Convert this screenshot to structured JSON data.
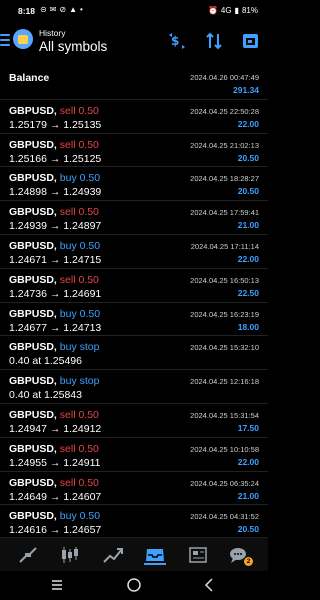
{
  "status_bar": {
    "time": "8:18",
    "notifications": [
      "⊝",
      "✉",
      "⊘",
      "▲",
      "•"
    ],
    "network": "4G",
    "battery": "81%"
  },
  "header": {
    "subtitle": "History",
    "title": "All symbols"
  },
  "balance": {
    "label": "Balance",
    "date": "2024.04.26 00:47:49",
    "value": "291.34"
  },
  "trades": [
    {
      "symbol": "GBPUSD,",
      "side": "sell 0.50",
      "type": "sell",
      "prices": "1.25179 → 1.25135",
      "date": "2024.04.25 22:50:28",
      "profit": "22.00"
    },
    {
      "symbol": "GBPUSD,",
      "side": "sell 0.50",
      "type": "sell",
      "prices": "1.25166 → 1.25125",
      "date": "2024.04.25 21:02:13",
      "profit": "20.50"
    },
    {
      "symbol": "GBPUSD,",
      "side": "buy 0.50",
      "type": "buy",
      "prices": "1.24898 → 1.24939",
      "date": "2024.04.25 18:28:27",
      "profit": "20.50"
    },
    {
      "symbol": "GBPUSD,",
      "side": "sell 0.50",
      "type": "sell",
      "prices": "1.24939 → 1.24897",
      "date": "2024.04.25 17:59:41",
      "profit": "21.00"
    },
    {
      "symbol": "GBPUSD,",
      "side": "buy 0.50",
      "type": "buy",
      "prices": "1.24671 → 1.24715",
      "date": "2024.04.25 17:11:14",
      "profit": "22.00"
    },
    {
      "symbol": "GBPUSD,",
      "side": "sell 0.50",
      "type": "sell",
      "prices": "1.24736 → 1.24691",
      "date": "2024.04.25 16:50:13",
      "profit": "22.50"
    },
    {
      "symbol": "GBPUSD,",
      "side": "buy 0.50",
      "type": "buy",
      "prices": "1.24677 → 1.24713",
      "date": "2024.04.25 16:23:19",
      "profit": "18.00"
    },
    {
      "symbol": "GBPUSD,",
      "side": "buy stop",
      "type": "buy",
      "prices": "0.40 at 1.25496",
      "date": "2024.04.25 15:32:10",
      "profit": ""
    },
    {
      "symbol": "GBPUSD,",
      "side": "buy stop",
      "type": "buy",
      "prices": "0.40 at 1.25843",
      "date": "2024.04.25 12:16:18",
      "profit": ""
    },
    {
      "symbol": "GBPUSD,",
      "side": "sell 0.50",
      "type": "sell",
      "prices": "1.24947 → 1.24912",
      "date": "2024.04.25 15:31:54",
      "profit": "17.50"
    },
    {
      "symbol": "GBPUSD,",
      "side": "sell 0.50",
      "type": "sell",
      "prices": "1.24955 → 1.24911",
      "date": "2024.04.25 10:10:58",
      "profit": "22.00"
    },
    {
      "symbol": "GBPUSD,",
      "side": "sell 0.50",
      "type": "sell",
      "prices": "1.24649 → 1.24607",
      "date": "2024.04.25 06:35:24",
      "profit": "21.00"
    },
    {
      "symbol": "GBPUSD,",
      "side": "buy 0.50",
      "type": "buy",
      "prices": "1.24616 → 1.24657",
      "date": "2024.04.25 04:31:52",
      "profit": "20.50"
    }
  ],
  "tabbar": {
    "chat_badge": "2"
  },
  "colors": {
    "accent": "#3ea0ff",
    "sell": "#e84545",
    "background": "#000000"
  }
}
